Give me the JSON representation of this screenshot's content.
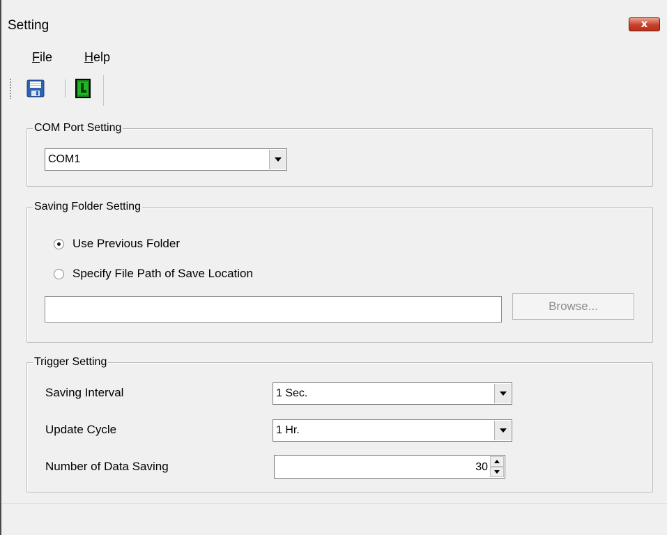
{
  "window": {
    "title": "Setting",
    "close_label": "x"
  },
  "menu": {
    "items": [
      {
        "accel": "F",
        "rest": "ile"
      },
      {
        "accel": "H",
        "rest": "elp"
      }
    ]
  },
  "toolbar": {
    "icons": [
      "save-icon",
      "exit-icon"
    ]
  },
  "com_port": {
    "legend": "COM Port Setting",
    "selected": "COM1"
  },
  "saving_folder": {
    "legend": "Saving Folder Setting",
    "option_previous": "Use Previous Folder",
    "option_specify": "Specify File Path of Save Location",
    "selected_option": "previous",
    "path_value": "",
    "browse_label": "Browse..."
  },
  "trigger": {
    "legend": "Trigger Setting",
    "saving_interval_label": "Saving Interval",
    "saving_interval_value": "1 Sec.",
    "update_cycle_label": "Update Cycle",
    "update_cycle_value": "1 Hr.",
    "data_saving_label": "Number of Data Saving",
    "data_saving_value": "30"
  },
  "colors": {
    "window_bg": "#f0f0f0",
    "close_button": "#c7402a",
    "disabled_text": "#8c8c8c"
  }
}
